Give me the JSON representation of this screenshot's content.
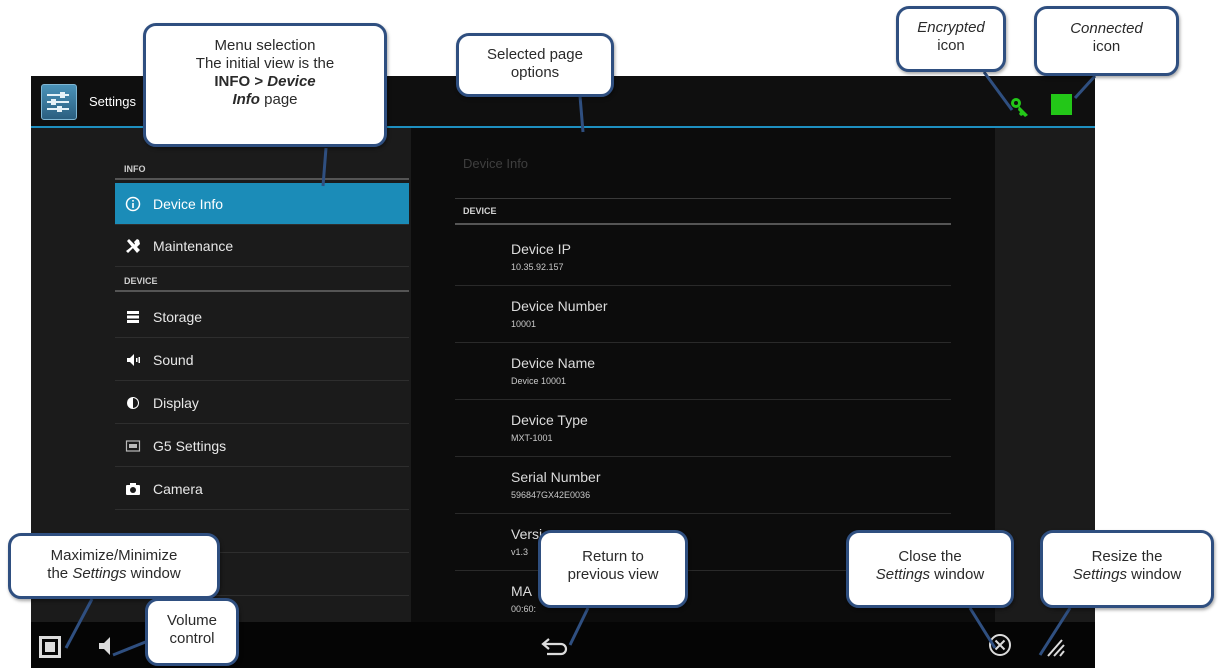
{
  "app": {
    "title": "Settings"
  },
  "menu": {
    "sections": [
      {
        "label": "INFO"
      },
      {
        "label": "DEVICE"
      }
    ],
    "items": [
      {
        "label": "Device Info",
        "icon": "info-circle-icon",
        "selected": true
      },
      {
        "label": "Maintenance",
        "icon": "tools-icon"
      },
      {
        "label": "Storage",
        "icon": "storage-icon"
      },
      {
        "label": "Sound",
        "icon": "speaker-icon"
      },
      {
        "label": "Display",
        "icon": "display-icon"
      },
      {
        "label": "G5 Settings",
        "icon": "g5-icon"
      },
      {
        "label": "Camera",
        "icon": "camera-icon"
      }
    ]
  },
  "page": {
    "title": "Device Info",
    "section": "DEVICE",
    "rows": [
      {
        "label": "Device IP",
        "value": "10.35.92.157"
      },
      {
        "label": "Device Number",
        "value": "10001"
      },
      {
        "label": "Device Name",
        "value": "Device 10001"
      },
      {
        "label": "Device Type",
        "value": "MXT-1001"
      },
      {
        "label": "Serial Number",
        "value": "596847GX42E0036"
      },
      {
        "label": "Versi",
        "value": "v1.3"
      },
      {
        "label": "MA",
        "value": "00:60:"
      }
    ]
  },
  "status": {
    "encrypted_icon": "key-icon",
    "connected_icon": "green-square-icon",
    "encrypted_color": "#23c718",
    "connected_color": "#23c718"
  },
  "bottombar": {
    "icons": [
      "maximize-minimize-icon",
      "volume-icon",
      "back-arrow-icon",
      "close-circle-icon",
      "resize-grip-icon"
    ]
  },
  "callouts": {
    "menu_selection": {
      "line1": "Menu selection",
      "line2": "The initial view is the",
      "bold1": "INFO > ",
      "bolditalic1": "Device",
      "bolditalic2": "Info",
      "tail": " page"
    },
    "selected_page": {
      "line1": "Selected page",
      "line2": "options"
    },
    "encrypted": {
      "italic": "Encrypted",
      "line2": "icon"
    },
    "connected": {
      "italic": "Connected",
      "line2": "icon"
    },
    "maximize": {
      "line1": "Maximize/Minimize",
      "pre": "the ",
      "italic": "Settings",
      "post": " window"
    },
    "volume": {
      "line1": "Volume",
      "line2": "control"
    },
    "return": {
      "line1": "Return to",
      "line2": "previous view"
    },
    "close": {
      "line1": "Close the",
      "italic": "Settings",
      "post": " window"
    },
    "resize": {
      "line1": "Resize the",
      "italic": "Settings",
      "post": " window"
    }
  },
  "colors": {
    "accent": "#1b8cb8",
    "callout_border": "#2f4f80"
  }
}
